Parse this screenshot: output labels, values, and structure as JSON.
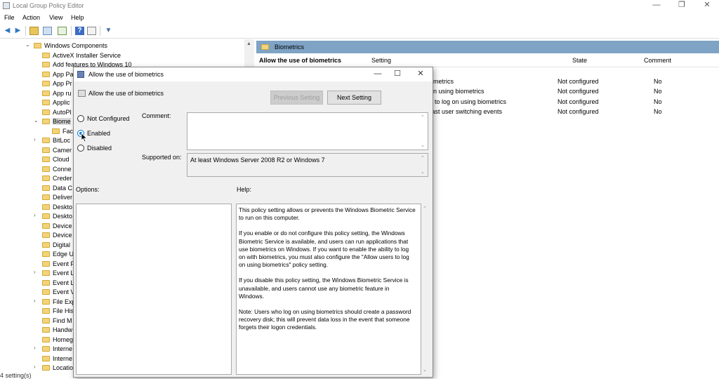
{
  "window": {
    "title": "Local Group Policy Editor"
  },
  "menu": [
    "File",
    "Action",
    "View",
    "Help"
  ],
  "tree": [
    {
      "label": "Windows Components",
      "depth": 0,
      "expander": "v",
      "selected": false
    },
    {
      "label": "ActiveX Installer Service",
      "depth": 1,
      "expander": "",
      "selected": false
    },
    {
      "label": "Add features to Windows 10",
      "depth": 1,
      "expander": "",
      "selected": false
    },
    {
      "label": "App Pa",
      "depth": 1,
      "expander": "",
      "selected": false
    },
    {
      "label": "App Pr",
      "depth": 1,
      "expander": "",
      "selected": false
    },
    {
      "label": "App ru",
      "depth": 1,
      "expander": "",
      "selected": false
    },
    {
      "label": "Applic",
      "depth": 1,
      "expander": "",
      "selected": false
    },
    {
      "label": "AutoPl",
      "depth": 1,
      "expander": "",
      "selected": false
    },
    {
      "label": "Biome",
      "depth": 1,
      "expander": "v",
      "selected": true
    },
    {
      "label": "Fac",
      "depth": 2,
      "expander": "",
      "selected": false
    },
    {
      "label": "BitLoc",
      "depth": 1,
      "expander": ">",
      "selected": false
    },
    {
      "label": "Camer",
      "depth": 1,
      "expander": "",
      "selected": false
    },
    {
      "label": "Cloud",
      "depth": 1,
      "expander": "",
      "selected": false
    },
    {
      "label": "Conne",
      "depth": 1,
      "expander": "",
      "selected": false
    },
    {
      "label": "Creder",
      "depth": 1,
      "expander": "",
      "selected": false
    },
    {
      "label": "Data C",
      "depth": 1,
      "expander": "",
      "selected": false
    },
    {
      "label": "Deliver",
      "depth": 1,
      "expander": "",
      "selected": false
    },
    {
      "label": "Deskto",
      "depth": 1,
      "expander": "",
      "selected": false
    },
    {
      "label": "Deskto",
      "depth": 1,
      "expander": ">",
      "selected": false
    },
    {
      "label": "Device",
      "depth": 1,
      "expander": "",
      "selected": false
    },
    {
      "label": "Device",
      "depth": 1,
      "expander": "",
      "selected": false
    },
    {
      "label": "Digital",
      "depth": 1,
      "expander": "",
      "selected": false
    },
    {
      "label": "Edge U",
      "depth": 1,
      "expander": "",
      "selected": false
    },
    {
      "label": "Event F",
      "depth": 1,
      "expander": "",
      "selected": false
    },
    {
      "label": "Event L",
      "depth": 1,
      "expander": ">",
      "selected": false
    },
    {
      "label": "Event L",
      "depth": 1,
      "expander": "",
      "selected": false
    },
    {
      "label": "Event V",
      "depth": 1,
      "expander": "",
      "selected": false
    },
    {
      "label": "File Exp",
      "depth": 1,
      "expander": ">",
      "selected": false
    },
    {
      "label": "File His",
      "depth": 1,
      "expander": "",
      "selected": false
    },
    {
      "label": "Find M",
      "depth": 1,
      "expander": "",
      "selected": false
    },
    {
      "label": "Handw",
      "depth": 1,
      "expander": "",
      "selected": false
    },
    {
      "label": "Homeg",
      "depth": 1,
      "expander": "",
      "selected": false
    },
    {
      "label": "Interne",
      "depth": 1,
      "expander": ">",
      "selected": false
    },
    {
      "label": "Interne",
      "depth": 1,
      "expander": "",
      "selected": false
    },
    {
      "label": "Locatio",
      "depth": 1,
      "expander": ">",
      "selected": false
    }
  ],
  "right_pane": {
    "header": "Biometrics",
    "detail_title": "Allow the use of biometrics",
    "columns": {
      "setting": "Setting",
      "state": "State",
      "comment": "Comment"
    },
    "rows": [
      {
        "setting": "ometrics",
        "state": "Not configured",
        "comment": "No"
      },
      {
        "setting": "on using biometrics",
        "state": "Not configured",
        "comment": "No"
      },
      {
        "setting": "s to log on using biometrics",
        "state": "Not configured",
        "comment": "No"
      },
      {
        "setting": "fast user switching events",
        "state": "Not configured",
        "comment": "No"
      }
    ]
  },
  "status_bar": "4 setting(s)",
  "dialog": {
    "title": "Allow the use of biometrics",
    "setting_name": "Allow the use of biometrics",
    "prev_button": "Previous Setting",
    "next_button": "Next Setting",
    "radios": [
      {
        "label": "Not Configured",
        "checked": false
      },
      {
        "label": "Enabled",
        "checked": true
      },
      {
        "label": "Disabled",
        "checked": false
      }
    ],
    "comment_label": "Comment:",
    "comment_value": "",
    "supported_label": "Supported on:",
    "supported_value": "At least Windows Server 2008 R2 or Windows 7",
    "options_label": "Options:",
    "help_label": "Help:",
    "help_paragraphs": [
      "This policy setting allows or prevents the Windows Biometric Service to run on this computer.",
      "If you enable or do not configure this policy setting, the Windows Biometric Service is available, and users can run applications that use biometrics on Windows. If you want to enable the ability to log on with biometrics, you must also configure the \"Allow users to log on using biometrics\" policy setting.",
      "If you disable this policy setting, the Windows Biometric Service is unavailable, and users cannot use any biometric feature in Windows.",
      "Note: Users who log on using biometrics should create a password recovery disk; this will prevent data loss in the event that someone forgets their logon credentials."
    ]
  }
}
